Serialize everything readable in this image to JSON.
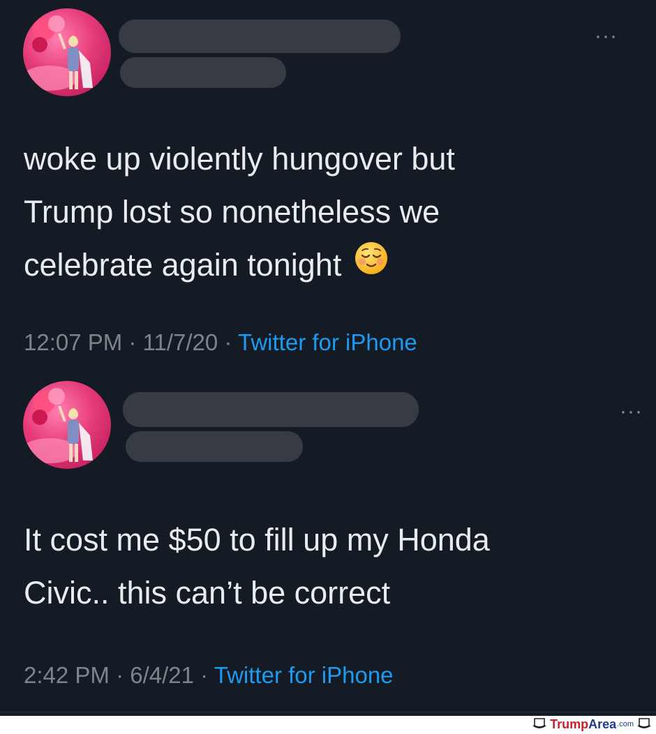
{
  "tweets": [
    {
      "text_lines": [
        "woke up violently hungover but",
        "Trump lost so nonetheless we",
        "celebrate again tonight"
      ],
      "emoji": "relieved-face-emoji",
      "time": "12:07 PM",
      "date": "11/7/20",
      "separator": "·",
      "source": "Twitter for iPhone",
      "more_label": "···"
    },
    {
      "text_lines": [
        "It cost me $50 to fill up my Honda",
        "Civic.. this can’t be correct"
      ],
      "time": "2:42 PM",
      "date": "6/4/21",
      "separator": "·",
      "source": "Twitter for iPhone",
      "more_label": "···"
    }
  ],
  "watermark": {
    "part1": "Trump",
    "part2": "Area",
    "suffix": ".com",
    "icon": "hat-icon"
  },
  "colors": {
    "background": "#141b24",
    "text": "#e9ecef",
    "meta": "#7d848c",
    "link": "#1d9bf0",
    "redaction": "#363b44"
  }
}
